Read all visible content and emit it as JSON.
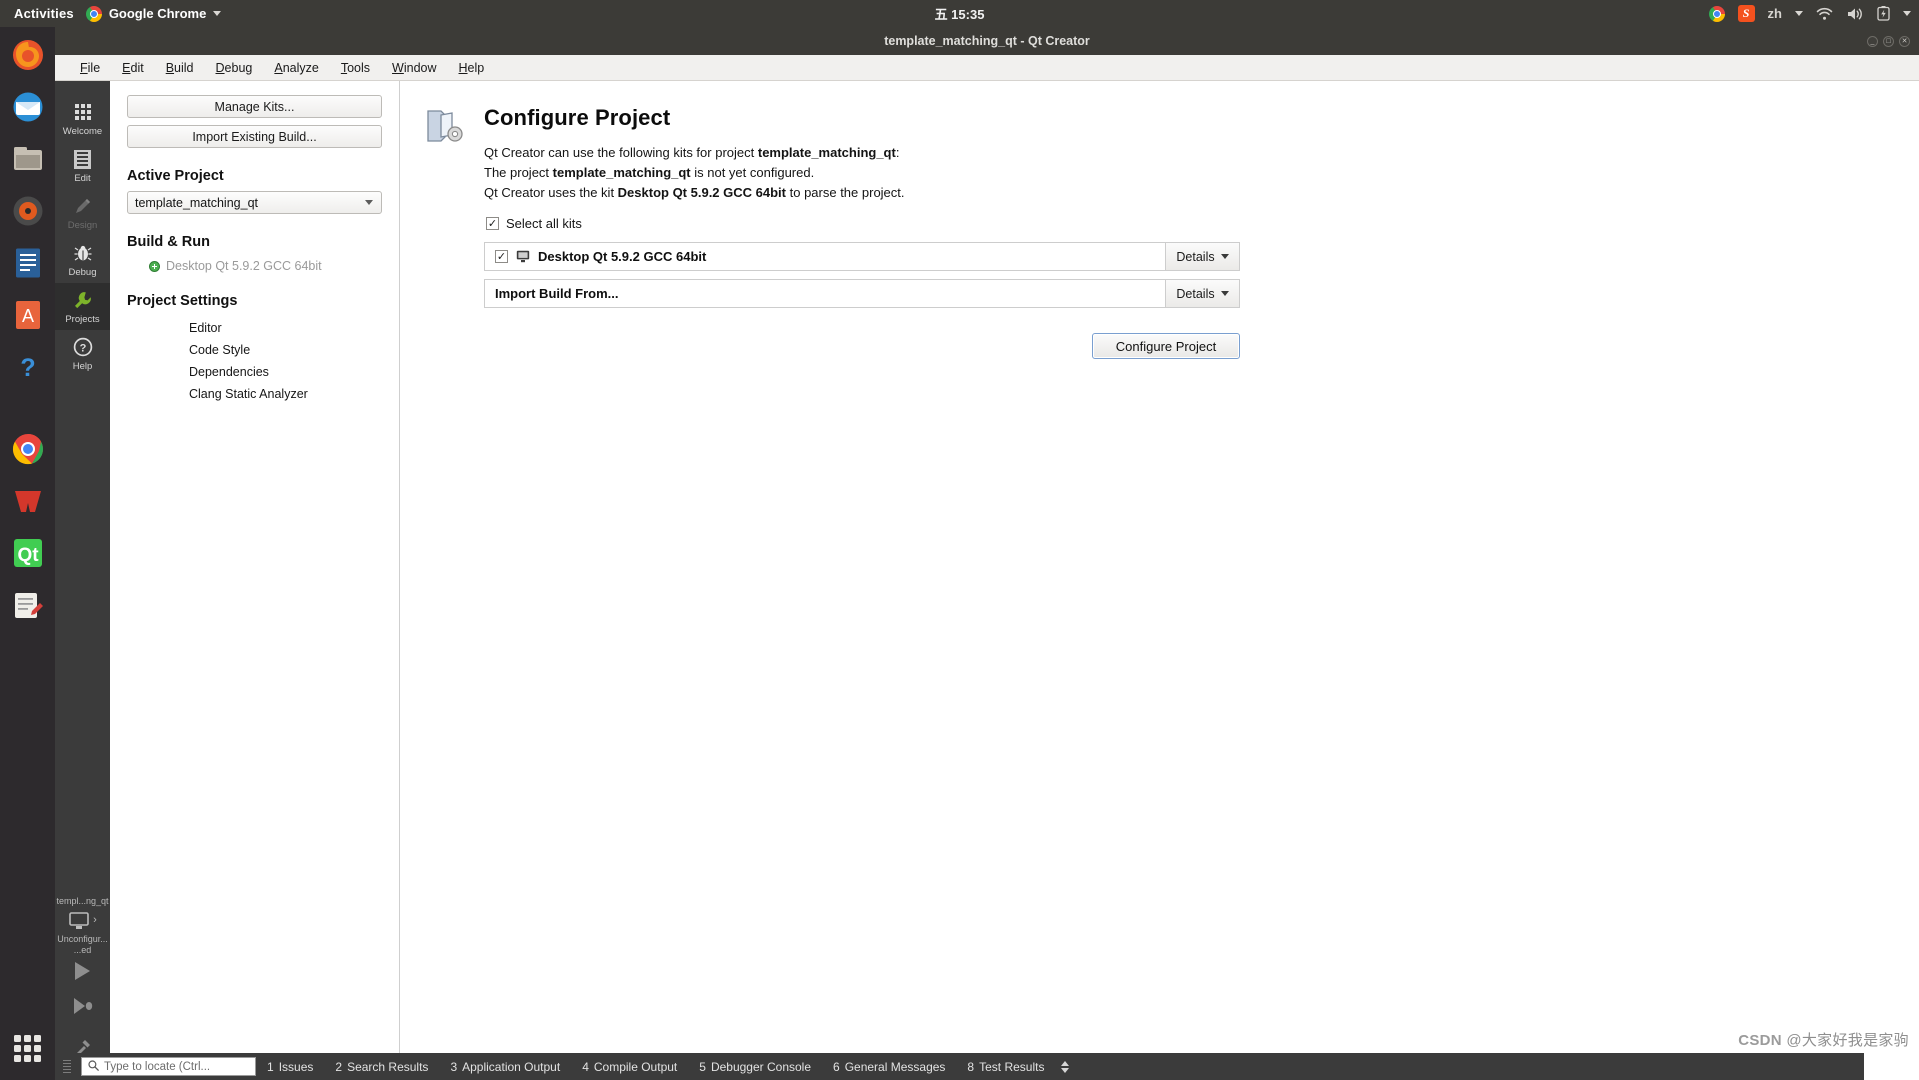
{
  "desktop": {
    "activities_label": "Activities",
    "app_menu_label": "Google Chrome",
    "clock": "五 15:35",
    "keyboard_layout": "zh"
  },
  "window": {
    "title": "template_matching_qt - Qt Creator",
    "menus": [
      {
        "mnemonic": "F",
        "rest": "ile"
      },
      {
        "mnemonic": "E",
        "rest": "dit"
      },
      {
        "mnemonic": "B",
        "rest": "uild"
      },
      {
        "mnemonic": "D",
        "rest": "ebug"
      },
      {
        "mnemonic": "A",
        "rest": "nalyze"
      },
      {
        "mnemonic": "T",
        "rest": "ools"
      },
      {
        "mnemonic": "W",
        "rest": "indow"
      },
      {
        "mnemonic": "H",
        "rest": "elp"
      }
    ]
  },
  "modebar": {
    "items": [
      {
        "label": "Welcome",
        "icon": "grid-icon",
        "state": "normal"
      },
      {
        "label": "Edit",
        "icon": "document-icon",
        "state": "normal"
      },
      {
        "label": "Design",
        "icon": "pencil-icon",
        "state": "disabled"
      },
      {
        "label": "Debug",
        "icon": "bug-icon",
        "state": "normal"
      },
      {
        "label": "Projects",
        "icon": "wrench-icon",
        "state": "active"
      },
      {
        "label": "Help",
        "icon": "question-icon",
        "state": "normal"
      }
    ],
    "target": {
      "project": "templ...ng_qt",
      "kit_line1": "Unconfigur...",
      "kit_line2": "...ed"
    }
  },
  "project_pane": {
    "manage_kits_label": "Manage Kits...",
    "import_existing_build_label": "Import Existing Build...",
    "active_project_heading": "Active Project",
    "active_project_value": "template_matching_qt",
    "build_run_heading": "Build & Run",
    "build_run_kit": "Desktop Qt 5.9.2 GCC 64bit",
    "project_settings_heading": "Project Settings",
    "settings_items": [
      "Editor",
      "Code Style",
      "Dependencies",
      "Clang Static Analyzer"
    ]
  },
  "configure": {
    "title": "Configure Project",
    "line1_prefix": "Qt Creator can use the following kits for project ",
    "line1_bold": "template_matching_qt",
    "line1_suffix": ":",
    "line2_prefix": "The project ",
    "line2_bold": "template_matching_qt",
    "line2_suffix": " is not yet configured.",
    "line3_prefix": "Qt Creator uses the kit ",
    "line3_bold": "Desktop Qt 5.9.2 GCC 64bit",
    "line3_suffix": " to parse the project.",
    "select_all_label": "Select all kits",
    "select_all_checked": "✓",
    "rows": [
      {
        "label": "Desktop Qt 5.9.2 GCC 64bit",
        "checked": "✓",
        "has_checkbox": true,
        "has_icon": true,
        "details_label": "Details"
      },
      {
        "label": "Import Build From...",
        "checked": "",
        "has_checkbox": false,
        "has_icon": false,
        "details_label": "Details"
      }
    ],
    "configure_button_label": "Configure Project"
  },
  "statusbar": {
    "locator_placeholder": "Type to locate (Ctrl...",
    "panes": [
      {
        "num": "1",
        "label": "Issues"
      },
      {
        "num": "2",
        "label": "Search Results"
      },
      {
        "num": "3",
        "label": "Application Output"
      },
      {
        "num": "4",
        "label": "Compile Output"
      },
      {
        "num": "5",
        "label": "Debugger Console"
      },
      {
        "num": "6",
        "label": "General Messages"
      },
      {
        "num": "8",
        "label": "Test Results"
      }
    ]
  },
  "watermark": {
    "brand": "CSDN",
    "text": "@大家好我是家驹"
  },
  "colors": {
    "accent_green": "#7db32a",
    "topbar": "#3c3b37",
    "mode_active": "#2e2e2e"
  }
}
